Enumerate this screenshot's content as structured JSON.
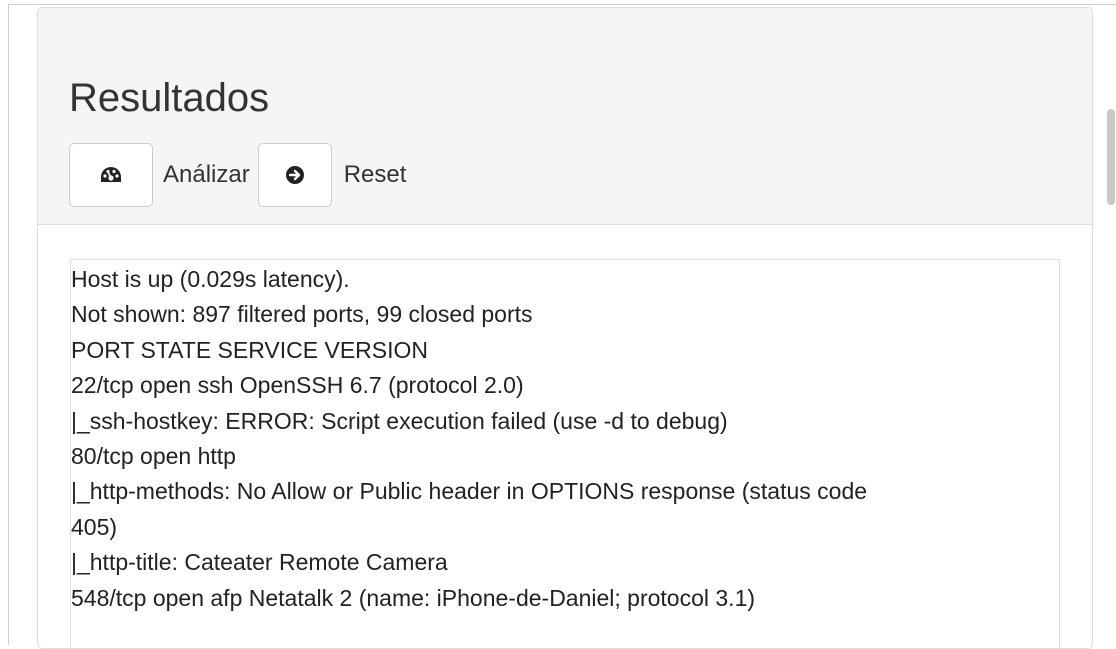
{
  "panel": {
    "title": "Resultados",
    "buttons": {
      "analyze_label": "Análizar",
      "reset_label": "Reset"
    }
  },
  "output": {
    "lines": [
      "Host is up (0.029s latency).",
      "Not shown: 897 filtered ports, 99 closed ports",
      "PORT STATE SERVICE VERSION",
      "22/tcp open ssh OpenSSH 6.7 (protocol 2.0)",
      "|_ssh-hostkey: ERROR: Script execution failed (use -d to debug)",
      "80/tcp open http",
      "|_http-methods: No Allow or Public header in OPTIONS response (status code",
      "405)",
      "|_http-title: Cateater Remote Camera",
      "548/tcp open afp Netatalk 2 (name: iPhone-de-Daniel; protocol 3.1)"
    ]
  },
  "icons": {
    "analyze": "dashboard-icon",
    "reset": "circle-arrow-right-icon"
  }
}
